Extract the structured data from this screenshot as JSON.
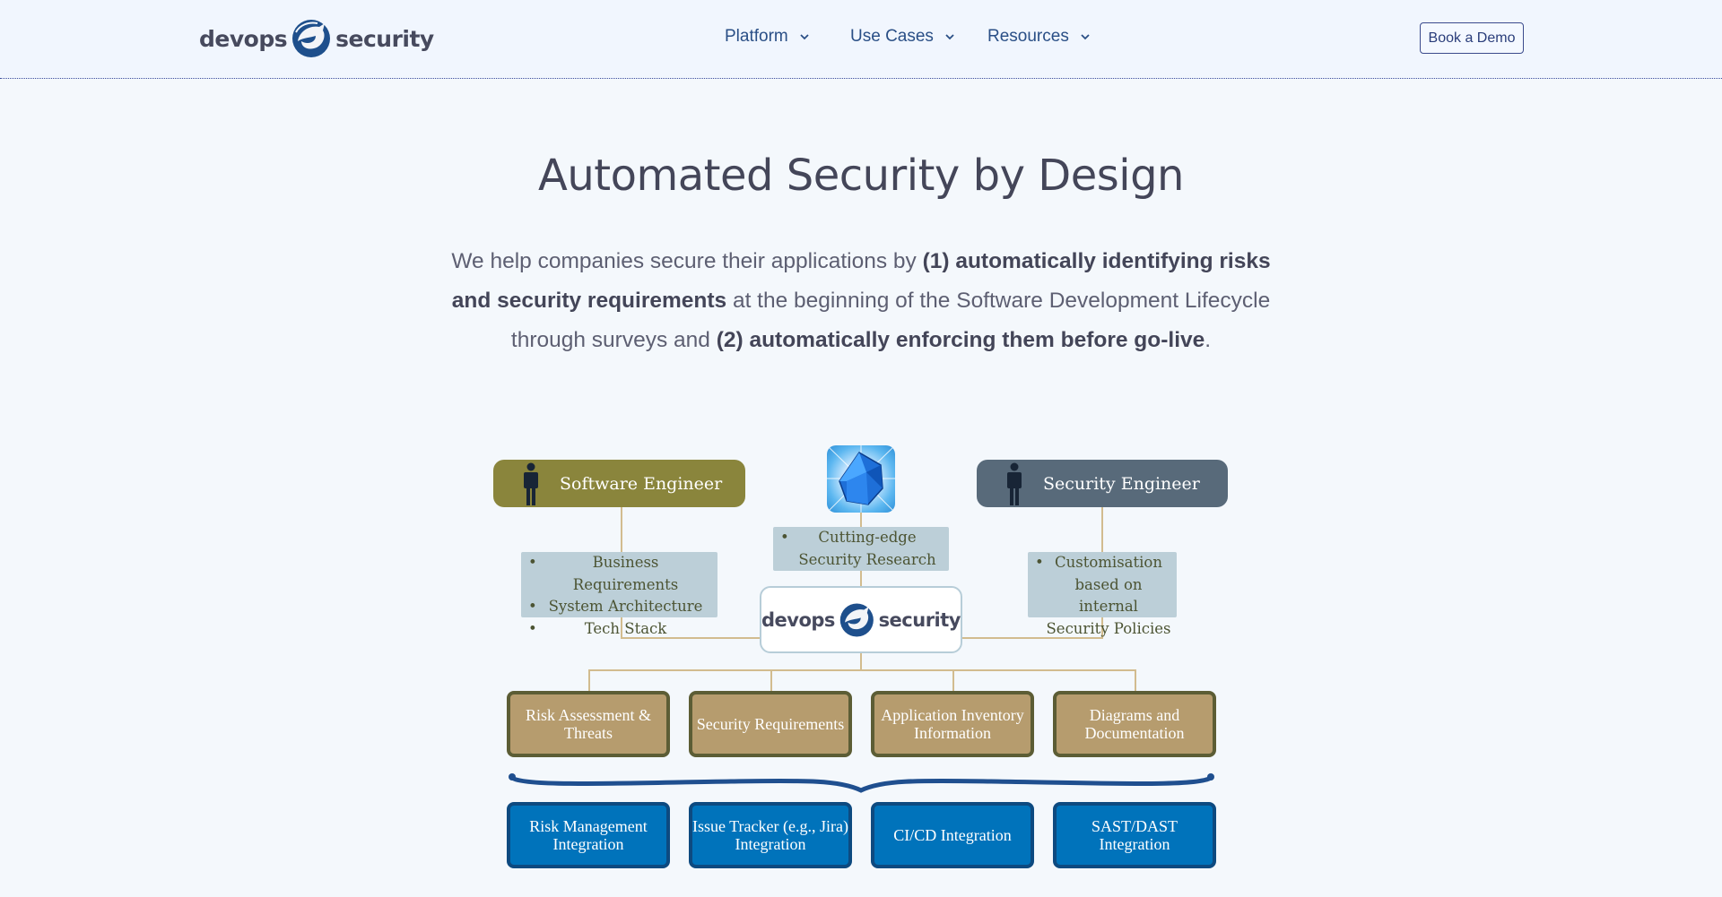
{
  "header": {
    "logo": {
      "left": "devops",
      "right": "security",
      "icon": "fox-logo-icon"
    },
    "nav": [
      {
        "label": "Platform",
        "icon": "chevron-down-icon"
      },
      {
        "label": "Use Cases",
        "icon": "chevron-down-icon"
      },
      {
        "label": "Resources",
        "icon": "chevron-down-icon"
      }
    ],
    "cta_label": "Book a Demo"
  },
  "hero": {
    "title": "Automated Security by Design",
    "text": {
      "p1": "We help companies secure their applications by ",
      "b1": "(1) automatically identifying risks and security requirements",
      "p2": " at the beginning of the Software Development Lifecycle through surveys and ",
      "b2": "(2) automatically enforcing them before go-live",
      "p3": "."
    }
  },
  "diagram": {
    "software_engineer": {
      "label": "Software Engineer",
      "icon": "person-icon",
      "bullets": [
        "Business Requirements",
        "System Architecture",
        "Tech Stack"
      ]
    },
    "research": {
      "icon": "crystal-gem-icon",
      "bullets": [
        "Cutting-edge Security Research"
      ]
    },
    "security_engineer": {
      "label": "Security Engineer",
      "icon": "person-icon",
      "bullets": [
        "Customisation based on internal Security Policies"
      ]
    },
    "center_logo": {
      "left": "devops",
      "right": "security"
    },
    "outputs": [
      "Risk Assessment & Threats",
      "Security Requirements",
      "Application Inventory Information",
      "Diagrams and Documentation"
    ],
    "integrations": [
      "Risk Management Integration",
      "Issue Tracker (e.g., Jira) Integration",
      "CI/CD Integration",
      "SAST/DAST Integration"
    ],
    "colors": {
      "software_engineer": "#8a853c",
      "security_engineer": "#586a7a",
      "output_box": "#b69c6e",
      "integration_box": "#0073bb",
      "brace": "#1f4f8f"
    }
  }
}
